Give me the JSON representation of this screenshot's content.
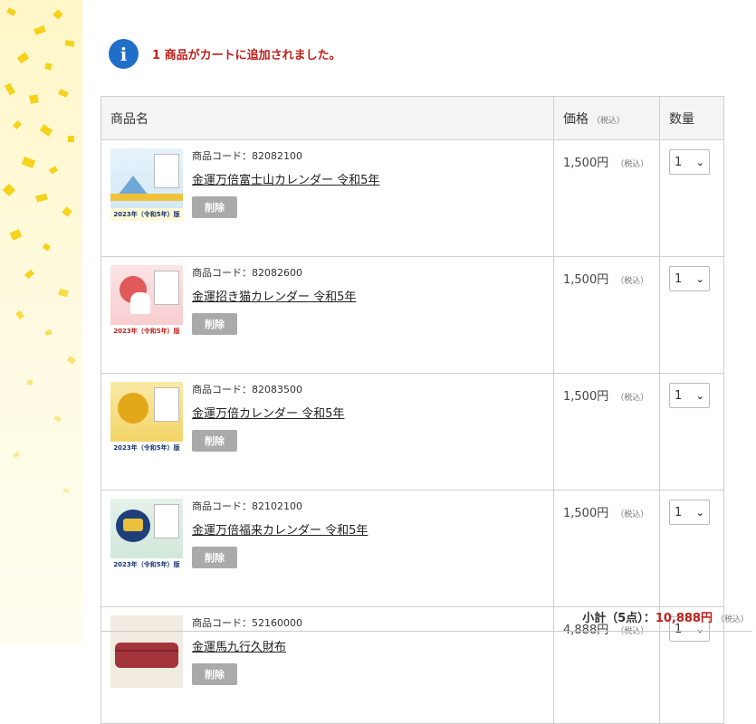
{
  "notice": {
    "message": "1 商品がカートに追加されました。"
  },
  "table": {
    "headers": {
      "name": "商品名",
      "price": "価格",
      "price_tax": "（税込）",
      "qty": "数量"
    },
    "delete_label": "削除",
    "code_prefix": "商品コード：",
    "rows": [
      {
        "code": "82082100",
        "name": "金運万倍富士山カレンダー 令和5年",
        "price": "1,500円",
        "tax": "（税込）",
        "qty": "1",
        "thumb_caption": "2023年（令和5年）版"
      },
      {
        "code": "82082600",
        "name": "金運招き猫カレンダー 令和5年",
        "price": "1,500円",
        "tax": "（税込）",
        "qty": "1",
        "thumb_caption": "2023年（令和5年）版"
      },
      {
        "code": "82083500",
        "name": "金運万倍カレンダー 令和5年",
        "price": "1,500円",
        "tax": "（税込）",
        "qty": "1",
        "thumb_caption": "2023年（令和5年）版"
      },
      {
        "code": "82102100",
        "name": "金運万倍福来カレンダー 令和5年",
        "price": "1,500円",
        "tax": "（税込）",
        "qty": "1",
        "thumb_caption": "2023年（令和5年）版"
      },
      {
        "code": "52160000",
        "name": "金運馬九行久財布",
        "price": "4,888円",
        "tax": "（税込）",
        "qty": "1"
      }
    ]
  },
  "subtotal": {
    "label": "小計（5点）：",
    "amount": "10,888円",
    "tax": "（税込）"
  },
  "colors": {
    "accent_red": "#c0201b",
    "info_blue": "#1f6fc8",
    "confetti": "#f6d21a"
  }
}
